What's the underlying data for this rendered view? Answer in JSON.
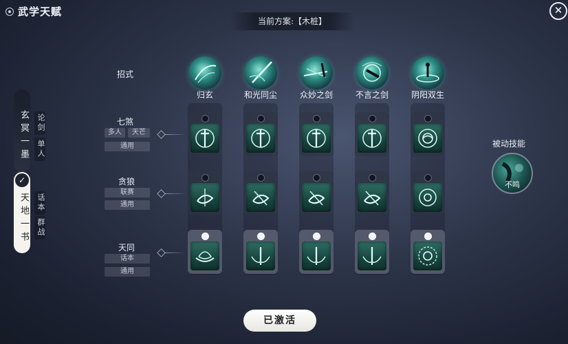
{
  "header": {
    "title": "武学天赋",
    "plan_text": "当前方案:【木桩】",
    "close_glyph": "✕"
  },
  "left_tabs": {
    "tab1": "玄冥一墨",
    "tab1_subs": [
      "论剑",
      "单人"
    ],
    "tab2": "天地一书",
    "tab2_subs": [
      "话本",
      "群战"
    ],
    "check_glyph": "✓"
  },
  "rows": {
    "zhaoshi": "招式",
    "qisha": {
      "name": "七煞",
      "tags": [
        "多人",
        "天芒"
      ],
      "tag2": "通用"
    },
    "tanlang": {
      "name": "贪狼",
      "tag1": "联赛",
      "tag2": "通用"
    },
    "tiantong": {
      "name": "天同",
      "tag1": "话本",
      "tag2": "通用"
    }
  },
  "skills": [
    {
      "name": "归玄"
    },
    {
      "name": "和光同尘"
    },
    {
      "name": "众妙之剑"
    },
    {
      "name": "不言之剑"
    },
    {
      "name": "阴阳双生"
    }
  ],
  "passive": {
    "label": "被动技能",
    "name": "不鸣"
  },
  "activate_button": "已激活",
  "colors": {
    "teal": "#2f8f86",
    "emblem": "#184640",
    "bg": "#2c3448"
  }
}
